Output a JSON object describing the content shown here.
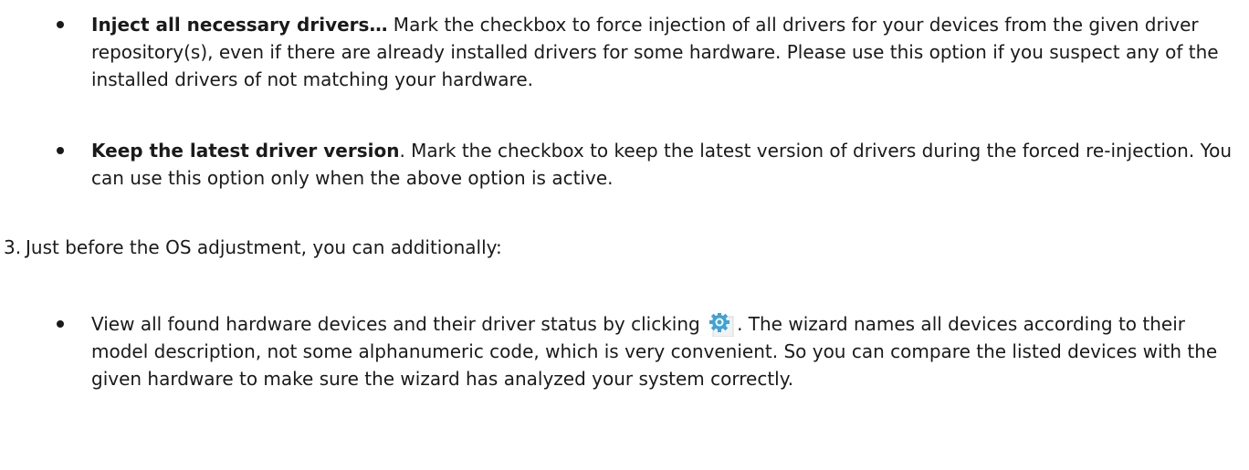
{
  "items": [
    {
      "bold": "Inject all necessary drivers…",
      "text": " Mark the checkbox to force injection of all drivers for your devices from the given driver repository(s), even if there are already installed drivers for some hardware. Please use this option if you suspect any of the installed drivers of not matching your hardware."
    },
    {
      "bold": "Keep the latest driver version",
      "text": ". Mark the checkbox to keep the latest version of drivers during the forced re-injection. You can use this option only when the above option is active."
    }
  ],
  "step3": {
    "number": "3.",
    "text": "Just before the OS adjustment, you can additionally:"
  },
  "view_item": {
    "text_before": "View all found hardware devices and their driver status by clicking",
    "text_after": ". The wizard names all devices according to their model description, not some alphanumeric code, which is very convenient. So you can compare the listed devices with the given hardware to make sure the wizard has analyzed your system correctly.",
    "icon": "gear-icon"
  },
  "colors": {
    "text": "#1a1a1a",
    "icon_blue": "#3fa3d8"
  }
}
